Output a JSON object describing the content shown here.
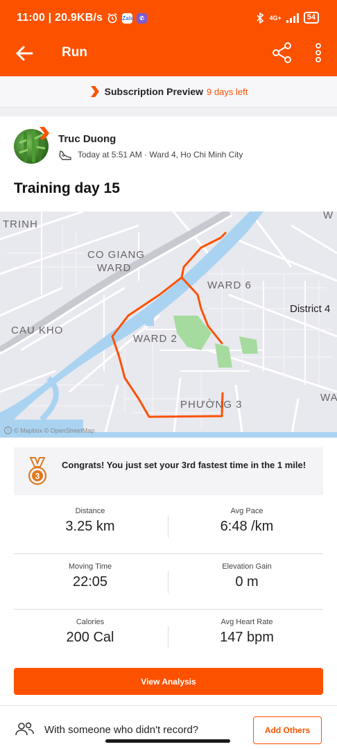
{
  "status_bar": {
    "time_speed": "11:00 | 20.9KB/s",
    "notif_icons": [
      "alarm-icon",
      "zalo-icon",
      "viber-icon"
    ],
    "network": "4G+",
    "battery": "54"
  },
  "app_bar": {
    "title": "Run"
  },
  "subscription": {
    "title": "Subscription Preview",
    "days_left": "9 days left"
  },
  "activity": {
    "athlete": "Truc Duong",
    "meta": "Today at 5:51 AM · Ward 4, Ho Chi Minh City",
    "title": "Training day 15"
  },
  "map": {
    "labels": {
      "trinh": "TRINH",
      "co_giang": "CO GIANG",
      "ward": "WARD",
      "ward6": "WARD 6",
      "district4": "District 4",
      "cau_kho": "CAU KHO",
      "ward2": "WARD 2",
      "phuong3": "PHƯỜNG 3",
      "wa": "WA",
      "w": "W"
    },
    "attribution": "© Mapbox © OpenStreetMap",
    "route_color": "#fc5200"
  },
  "achievement": {
    "text": "Congrats! You just set your 3rd fastest time in the 1 mile!",
    "rank": "3"
  },
  "stats": {
    "distance": {
      "label": "Distance",
      "value": "3.25 km"
    },
    "avg_pace": {
      "label": "Avg Pace",
      "value": "6:48 /km"
    },
    "moving_time": {
      "label": "Moving Time",
      "value": "22:05"
    },
    "elevation_gain": {
      "label": "Elevation Gain",
      "value": "0 m"
    },
    "calories": {
      "label": "Calories",
      "value": "200 Cal"
    },
    "avg_heart_rate": {
      "label": "Avg Heart Rate",
      "value": "147 bpm"
    }
  },
  "actions": {
    "view_analysis": "View Analysis",
    "invite_text": "With someone who didn't record?",
    "add_others": "Add Others"
  },
  "colors": {
    "brand": "#fc5200",
    "park": "#a6dba0",
    "water": "#aad3f2"
  }
}
